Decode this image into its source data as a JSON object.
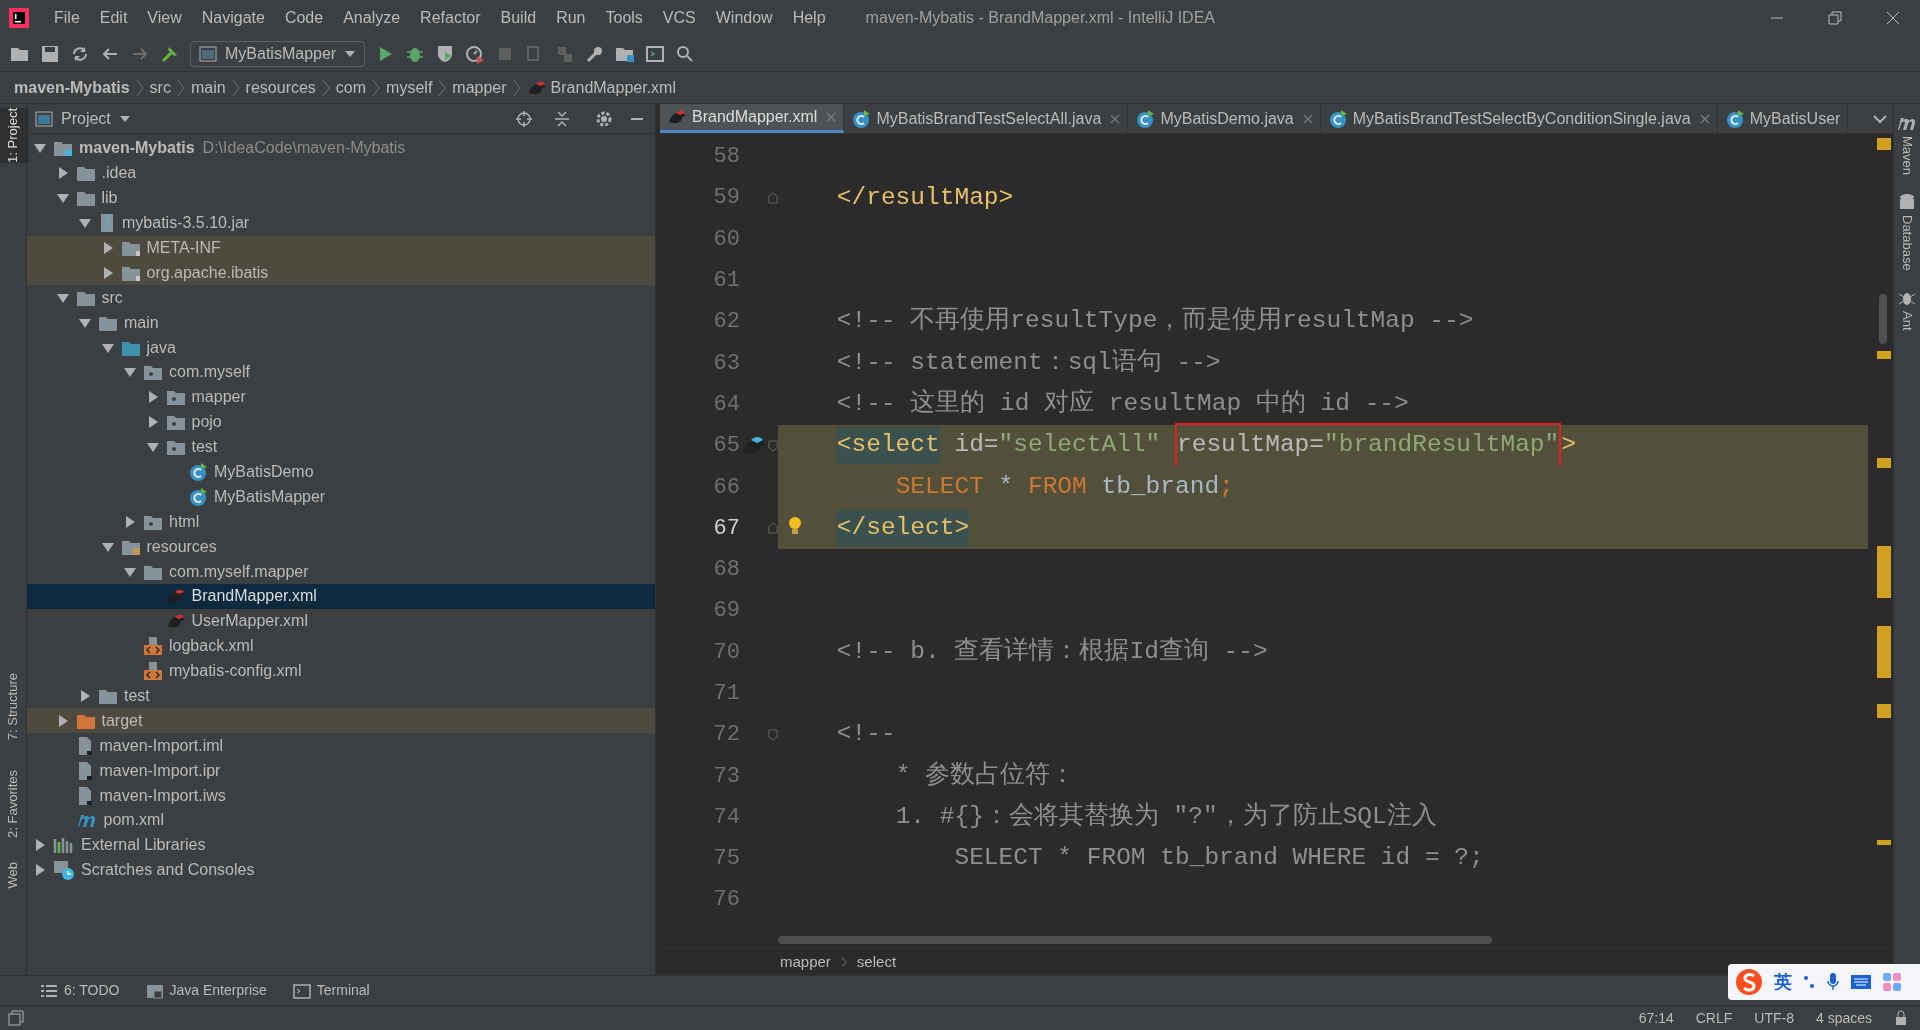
{
  "title_bar": {
    "menu": [
      "File",
      "Edit",
      "View",
      "Navigate",
      "Code",
      "Analyze",
      "Refactor",
      "Build",
      "Run",
      "Tools",
      "VCS",
      "Window",
      "Help"
    ],
    "title": "maven-Mybatis - BrandMapper.xml - IntelliJ IDEA"
  },
  "toolbar": {
    "run_configuration": "MyBatisMapper"
  },
  "breadcrumb": [
    {
      "label": "maven-Mybatis",
      "kind": "module"
    },
    {
      "label": "src",
      "kind": "folder"
    },
    {
      "label": "main",
      "kind": "folder"
    },
    {
      "label": "resources",
      "kind": "folder"
    },
    {
      "label": "com",
      "kind": "folder"
    },
    {
      "label": "myself",
      "kind": "folder"
    },
    {
      "label": "mapper",
      "kind": "folder"
    },
    {
      "label": "BrandMapper.xml",
      "kind": "file"
    }
  ],
  "left_stripe": [
    {
      "label": "1: Project",
      "selected": true
    },
    {
      "label": "7: Structure",
      "selected": false
    },
    {
      "label": "2: Favorites",
      "selected": false
    },
    {
      "label": "Web",
      "selected": false
    }
  ],
  "project_panel": {
    "title": "Project",
    "tree": [
      {
        "label": "maven-Mybatis",
        "note": "D:\\IdeaCode\\maven-Mybatis",
        "kind": "module",
        "expanded": true,
        "selected": false,
        "highlighted": false,
        "children": [
          {
            "label": ".idea",
            "kind": "folder",
            "expanded": false,
            "selected": false,
            "highlighted": false
          },
          {
            "label": "lib",
            "kind": "folder",
            "expanded": true,
            "selected": false,
            "highlighted": false,
            "children": [
              {
                "label": "mybatis-3.5.10.jar",
                "kind": "jar",
                "expanded": true,
                "selected": false,
                "highlighted": false,
                "children": [
                  {
                    "label": "META-INF",
                    "kind": "jar-folder",
                    "expanded": false,
                    "selected": false,
                    "highlighted": true
                  },
                  {
                    "label": "org.apache.ibatis",
                    "kind": "jar-folder",
                    "expanded": false,
                    "selected": false,
                    "highlighted": true
                  }
                ]
              }
            ]
          },
          {
            "label": "src",
            "kind": "folder",
            "expanded": true,
            "selected": false,
            "highlighted": false,
            "children": [
              {
                "label": "main",
                "kind": "folder",
                "expanded": true,
                "selected": false,
                "highlighted": false,
                "children": [
                  {
                    "label": "java",
                    "kind": "source",
                    "expanded": true,
                    "selected": false,
                    "highlighted": false,
                    "children": [
                      {
                        "label": "com.myself",
                        "kind": "package",
                        "expanded": true,
                        "selected": false,
                        "highlighted": false,
                        "children": [
                          {
                            "label": "mapper",
                            "kind": "package",
                            "expanded": false,
                            "selected": false,
                            "highlighted": false
                          },
                          {
                            "label": "pojo",
                            "kind": "package",
                            "expanded": false,
                            "selected": false,
                            "highlighted": false
                          },
                          {
                            "label": "test",
                            "kind": "package",
                            "expanded": true,
                            "selected": false,
                            "highlighted": false,
                            "children": [
                              {
                                "label": "MyBatisDemo",
                                "kind": "class",
                                "selected": false,
                                "highlighted": false
                              },
                              {
                                "label": "MyBatisMapper",
                                "kind": "class",
                                "selected": false,
                                "highlighted": false
                              }
                            ]
                          }
                        ]
                      },
                      {
                        "label": "html",
                        "kind": "package",
                        "expanded": false,
                        "selected": false,
                        "highlighted": false
                      }
                    ]
                  },
                  {
                    "label": "resources",
                    "kind": "resources",
                    "expanded": true,
                    "selected": false,
                    "highlighted": false,
                    "children": [
                      {
                        "label": "com.myself.mapper",
                        "kind": "folder",
                        "expanded": true,
                        "selected": false,
                        "highlighted": false,
                        "children": [
                          {
                            "label": "BrandMapper.xml",
                            "kind": "mybatis",
                            "selected": true,
                            "highlighted": false
                          },
                          {
                            "label": "UserMapper.xml",
                            "kind": "mybatis",
                            "selected": false,
                            "highlighted": false
                          }
                        ]
                      },
                      {
                        "label": "logback.xml",
                        "kind": "xml",
                        "selected": false,
                        "highlighted": false
                      },
                      {
                        "label": "mybatis-config.xml",
                        "kind": "xml",
                        "selected": false,
                        "highlighted": false
                      }
                    ]
                  }
                ]
              },
              {
                "label": "test",
                "kind": "folder",
                "expanded": false,
                "selected": false,
                "highlighted": false
              }
            ]
          },
          {
            "label": "target",
            "kind": "excluded",
            "expanded": false,
            "selected": false,
            "highlighted": true
          },
          {
            "label": "maven-Import.iml",
            "kind": "file",
            "selected": false,
            "highlighted": false
          },
          {
            "label": "maven-Import.ipr",
            "kind": "file",
            "selected": false,
            "highlighted": false
          },
          {
            "label": "maven-Import.iws",
            "kind": "file",
            "selected": false,
            "highlighted": false
          },
          {
            "label": "pom.xml",
            "kind": "maven",
            "selected": false,
            "highlighted": false
          }
        ]
      },
      {
        "label": "External Libraries",
        "kind": "libraries",
        "expanded": false,
        "selected": false,
        "highlighted": false
      },
      {
        "label": "Scratches and Consoles",
        "kind": "scratches",
        "expanded": false,
        "selected": false,
        "highlighted": false
      }
    ]
  },
  "tabs": [
    {
      "label": "BrandMapper.xml",
      "kind": "xml",
      "selected": true,
      "closable": true
    },
    {
      "label": "MyBatisBrandTestSelectAll.java",
      "kind": "java",
      "selected": false,
      "closable": true
    },
    {
      "label": "MyBatisDemo.java",
      "kind": "java",
      "selected": false,
      "closable": true
    },
    {
      "label": "MyBatisBrandTestSelectByConditionSingle.java",
      "kind": "java",
      "selected": false,
      "closable": true
    },
    {
      "label": "MyBatisUser",
      "kind": "java",
      "selected": false,
      "closable": false
    }
  ],
  "editor": {
    "lines": [
      {
        "number": "58",
        "current": false,
        "highlighted": false
      },
      {
        "number": "59",
        "current": false,
        "highlighted": false,
        "gutter_icons": [
          {
            "kind": "fold-end"
          }
        ],
        "segments": [
          {
            "kind": "tag",
            "text": "    </resultMap>"
          }
        ]
      },
      {
        "number": "60",
        "current": false,
        "highlighted": false
      },
      {
        "number": "61",
        "current": false,
        "highlighted": false
      },
      {
        "number": "62",
        "current": false,
        "highlighted": false,
        "segments": [
          {
            "kind": "comment",
            "text": "    <!-- 不再使用resultType，而是使用resultMap -->"
          }
        ]
      },
      {
        "number": "63",
        "current": false,
        "highlighted": false,
        "segments": [
          {
            "kind": "comment",
            "text": "    <!-- statement：sql语句 -->"
          }
        ]
      },
      {
        "number": "64",
        "current": false,
        "highlighted": false,
        "segments": [
          {
            "kind": "comment",
            "text": "    <!-- 这里的 id 对应 resultMap 中的 id -->"
          }
        ]
      },
      {
        "number": "65",
        "current": false,
        "highlighted": true,
        "gutter_icons": [
          {
            "kind": "mybatis"
          },
          {
            "kind": "fold-start"
          }
        ],
        "segments": [
          {
            "kind": "tag",
            "text": "    <select",
            "matched": true
          },
          {
            "kind": "attr",
            "text": " id="
          },
          {
            "kind": "value",
            "text": "\"selectAll\""
          },
          {
            "kind": "attr",
            "text": " resultMap=",
            "boxed": true
          },
          {
            "kind": "value",
            "text": "\"brandResultMap\"",
            "boxed": true
          },
          {
            "kind": "tag",
            "text": ">"
          }
        ]
      },
      {
        "number": "66",
        "current": false,
        "highlighted": true,
        "segments": [
          {
            "kind": "keyword",
            "text": "        SELECT "
          },
          {
            "kind": "plain",
            "text": "* "
          },
          {
            "kind": "keyword",
            "text": "FROM "
          },
          {
            "kind": "plain",
            "text": "tb_brand"
          },
          {
            "kind": "keyword",
            "text": ";"
          }
        ]
      },
      {
        "number": "67",
        "current": true,
        "highlighted": true,
        "gutter_icons": [
          {
            "kind": "fold-end"
          },
          {
            "kind": "bulb"
          }
        ],
        "segments": [
          {
            "kind": "tag",
            "text": "    </select>",
            "matched": true
          }
        ]
      },
      {
        "number": "68",
        "current": false,
        "highlighted": false
      },
      {
        "number": "69",
        "current": false,
        "highlighted": false
      },
      {
        "number": "70",
        "current": false,
        "highlighted": false,
        "segments": [
          {
            "kind": "comment",
            "text": "    <!-- b. 查看详情：根据Id查询 -->"
          }
        ]
      },
      {
        "number": "71",
        "current": false,
        "highlighted": false
      },
      {
        "number": "72",
        "current": false,
        "highlighted": false,
        "gutter_icons": [
          {
            "kind": "fold-start"
          }
        ],
        "segments": [
          {
            "kind": "comment",
            "text": "    <!--"
          }
        ]
      },
      {
        "number": "73",
        "current": false,
        "highlighted": false,
        "segments": [
          {
            "kind": "comment",
            "text": "        * 参数占位符："
          }
        ]
      },
      {
        "number": "74",
        "current": false,
        "highlighted": false,
        "segments": [
          {
            "kind": "comment",
            "text": "        1. #{}：会将其替换为 \"?\"，为了防止SQL注入"
          }
        ]
      },
      {
        "number": "75",
        "current": false,
        "highlighted": false,
        "segments": [
          {
            "kind": "comment",
            "text": "            SELECT * FROM tb_brand WHERE id = ?;"
          }
        ]
      },
      {
        "number": "76",
        "current": false,
        "highlighted": false
      }
    ],
    "breadcrumb": [
      "mapper",
      "select"
    ]
  },
  "right_stripe": [
    "Maven",
    "Database",
    "Ant"
  ],
  "tool_tabs": [
    "6: TODO",
    "Java Enterprise",
    "Terminal"
  ],
  "status_bar": [
    "67:14",
    "CRLF",
    "UTF-8",
    "4 spaces"
  ],
  "ime": {
    "label": "英"
  }
}
